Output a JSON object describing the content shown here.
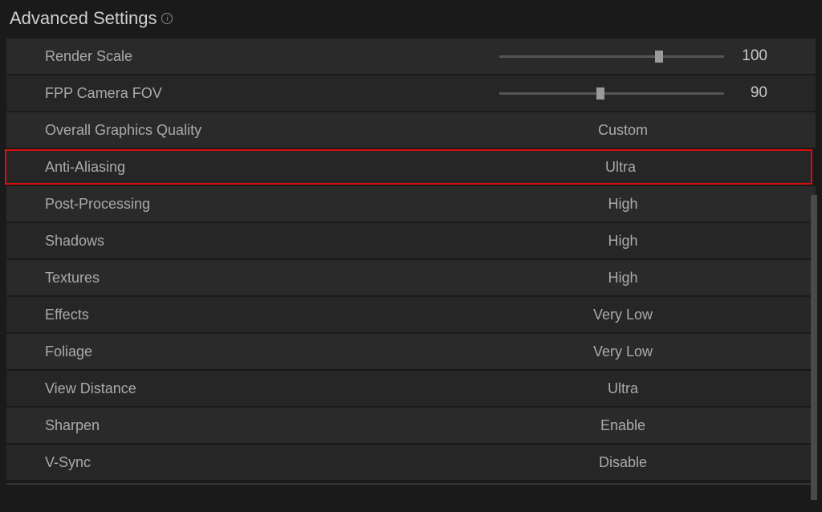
{
  "header": {
    "title": "Advanced Settings"
  },
  "settings": {
    "renderScale": {
      "label": "Render Scale",
      "value": "100",
      "sliderPercent": 71
    },
    "fppCameraFov": {
      "label": "FPP Camera FOV",
      "value": "90",
      "sliderPercent": 45
    },
    "overallGraphics": {
      "label": "Overall Graphics Quality",
      "value": "Custom"
    },
    "antiAliasing": {
      "label": "Anti-Aliasing",
      "value": "Ultra"
    },
    "postProcessing": {
      "label": "Post-Processing",
      "value": "High"
    },
    "shadows": {
      "label": "Shadows",
      "value": "High"
    },
    "textures": {
      "label": "Textures",
      "value": "High"
    },
    "effects": {
      "label": "Effects",
      "value": "Very Low"
    },
    "foliage": {
      "label": "Foliage",
      "value": "Very Low"
    },
    "viewDistance": {
      "label": "View Distance",
      "value": "Ultra"
    },
    "sharpen": {
      "label": "Sharpen",
      "value": "Enable"
    },
    "vsync": {
      "label": "V-Sync",
      "value": "Disable"
    }
  }
}
